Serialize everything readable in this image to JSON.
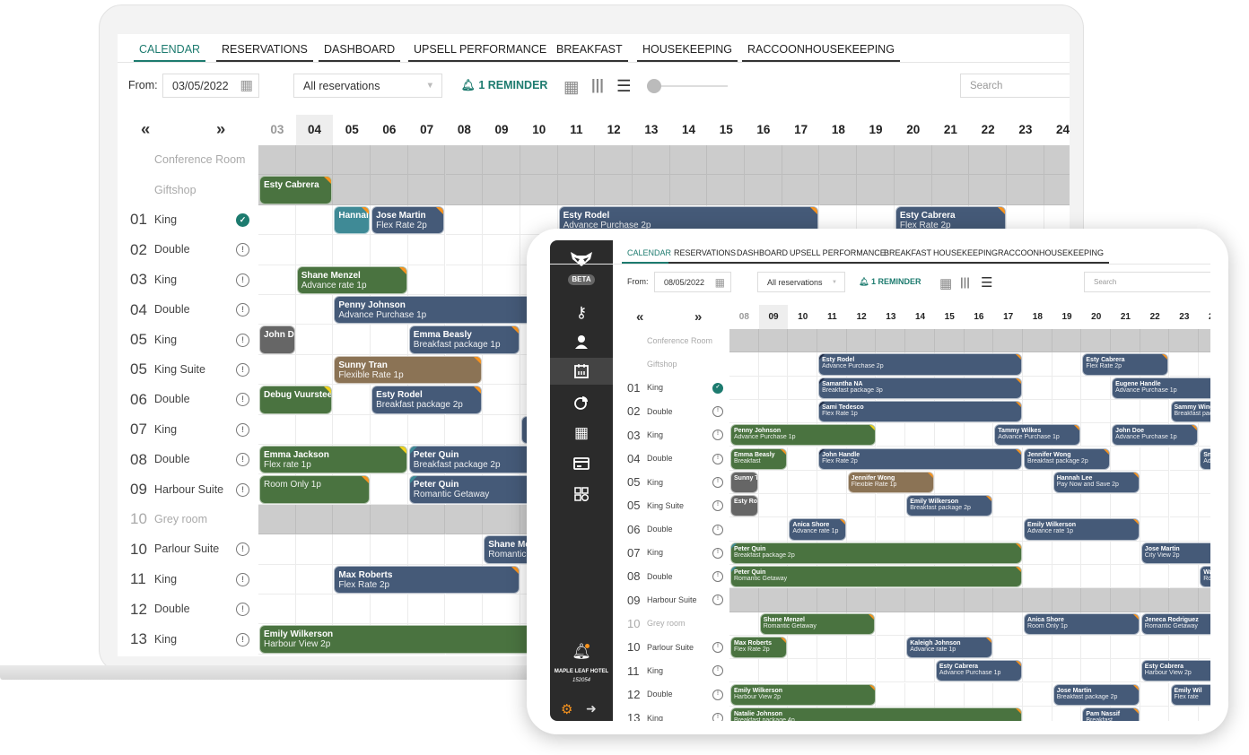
{
  "colors": {
    "blue": "#455a78",
    "green": "#4a7340",
    "teal": "#3f8a96",
    "grey": "#666666",
    "brown": "#8b7355",
    "accent": "#1d7b6f",
    "orange": "#f7931e",
    "yellow": "#f2d21b"
  },
  "laptop": {
    "tabs": [
      "CALENDAR",
      "RESERVATIONS",
      "DASHBOARD",
      "UPSELL PERFORMANCE",
      "BREAKFAST",
      "HOUSEKEEPING",
      "RACCOONHOUSEKEEPING"
    ],
    "from_label": "From:",
    "from_date": "03/05/2022",
    "filter": "All reservations",
    "reminder": "1 REMINDER",
    "search_placeholder": "Search",
    "prev": "«",
    "next": "»",
    "days": [
      "03",
      "04",
      "05",
      "06",
      "07",
      "08",
      "09",
      "10",
      "11",
      "12",
      "13",
      "14",
      "15",
      "16",
      "17",
      "18",
      "19",
      "20",
      "21",
      "22",
      "23",
      "24"
    ],
    "today": "04",
    "rooms": [
      {
        "num": "",
        "name": "Conference Room",
        "status": "none",
        "blocked": true
      },
      {
        "num": "",
        "name": "Giftshop",
        "status": "none",
        "blocked": true
      },
      {
        "num": "01",
        "name": "King",
        "status": "ok"
      },
      {
        "num": "02",
        "name": "Double",
        "status": "alert"
      },
      {
        "num": "03",
        "name": "King",
        "status": "alert"
      },
      {
        "num": "04",
        "name": "Double",
        "status": "alert"
      },
      {
        "num": "05",
        "name": "King",
        "status": "alert"
      },
      {
        "num": "05",
        "name": "King Suite",
        "status": "alert"
      },
      {
        "num": "06",
        "name": "Double",
        "status": "alert"
      },
      {
        "num": "07",
        "name": "King",
        "status": "alert"
      },
      {
        "num": "08",
        "name": "Double",
        "status": "alert"
      },
      {
        "num": "09",
        "name": "Harbour Suite",
        "status": "alert"
      },
      {
        "num": "10",
        "name": "Grey room",
        "status": "none",
        "blocked": true,
        "muted": true
      },
      {
        "num": "10",
        "name": "Parlour Suite",
        "status": "alert"
      },
      {
        "num": "11",
        "name": "King",
        "status": "alert"
      },
      {
        "num": "12",
        "name": "Double",
        "status": "alert"
      },
      {
        "num": "13",
        "name": "King",
        "status": "alert"
      }
    ],
    "bookings": [
      {
        "row": 1,
        "start": "03",
        "nights": 2,
        "name": "Esty Cabrera",
        "rate": "",
        "color": "green",
        "flag": "orange"
      },
      {
        "row": 2,
        "start": "05",
        "nights": 1,
        "name": "Hannal Lee",
        "rate": "",
        "color": "teal",
        "flag": "orange"
      },
      {
        "row": 2,
        "start": "06",
        "nights": 2,
        "name": "Jose Martin",
        "rate": "Flex Rate 2p",
        "color": "blue",
        "flag": "orange"
      },
      {
        "row": 2,
        "start": "11",
        "nights": 7,
        "name": "Esty Rodel",
        "rate": "Advance Purchase 2p",
        "color": "blue",
        "flag": "orange"
      },
      {
        "row": 2,
        "start": "20",
        "nights": 3,
        "name": "Esty Cabrera",
        "rate": "Flex Rate 2p",
        "color": "blue",
        "flag": "orange"
      },
      {
        "row": 4,
        "start": "04",
        "nights": 3,
        "name": "Shane Menzel",
        "rate": "Advance rate 1p",
        "color": "green",
        "flag": "orange"
      },
      {
        "row": 5,
        "start": "05",
        "nights": 8,
        "name": "Penny Johnson",
        "rate": "Advance Purchase 1p",
        "color": "blue",
        "flag": ""
      },
      {
        "row": 6,
        "start": "03",
        "nights": 1,
        "name": "John Doe",
        "rate": "",
        "color": "grey",
        "flag": ""
      },
      {
        "row": 6,
        "start": "07",
        "nights": 3,
        "name": "Emma Beasly",
        "rate": "Breakfast package 1p",
        "color": "blue",
        "flag": "orange"
      },
      {
        "row": 7,
        "start": "05",
        "nights": 4,
        "name": "Sunny Tran",
        "rate": "Flexible Rate 1p",
        "color": "brown",
        "flag": "orange"
      },
      {
        "row": 8,
        "start": "03",
        "nights": 2,
        "name": "Debug Vuursteen",
        "rate": "",
        "color": "green",
        "flag": "yellow"
      },
      {
        "row": 8,
        "start": "06",
        "nights": 3,
        "name": "Esty Rodel",
        "rate": "Breakfast package 2p",
        "color": "blue",
        "flag": "orange"
      },
      {
        "row": 9,
        "start": "10",
        "nights": 4,
        "name": "",
        "rate": "",
        "color": "blue",
        "flag": ""
      },
      {
        "row": 10,
        "start": "03",
        "nights": 4,
        "name": "Emma Jackson",
        "rate": "Flex rate 1p",
        "color": "green",
        "flag": "yellow"
      },
      {
        "row": 10,
        "start": "07",
        "nights": 5,
        "name": "Peter Quin",
        "rate": "Breakfast package 2p",
        "color": "blue",
        "flag": "",
        "lflag": "teal"
      },
      {
        "row": 11,
        "start": "03",
        "nights": 3,
        "name": "",
        "rate": "Room Only 1p",
        "color": "green",
        "flag": "orange"
      },
      {
        "row": 11,
        "start": "07",
        "nights": 5,
        "name": "Peter Quin",
        "rate": "Romantic Getaway",
        "color": "blue",
        "flag": "",
        "lflag": "teal"
      },
      {
        "row": 13,
        "start": "09",
        "nights": 3,
        "name": "Shane Menzel",
        "rate": "Romantic Getaway",
        "color": "blue",
        "flag": ""
      },
      {
        "row": 14,
        "start": "05",
        "nights": 5,
        "name": "Max Roberts",
        "rate": "Flex Rate 2p",
        "color": "blue",
        "flag": "orange"
      },
      {
        "row": 16,
        "start": "03",
        "nights": 10,
        "name": "Emily Wilkerson",
        "rate": "Harbour View 2p",
        "color": "green",
        "flag": ""
      }
    ]
  },
  "tablet": {
    "logo": "raccoon-logo",
    "beta": "BETA",
    "nav_icons": [
      "key-icon",
      "person-icon",
      "calendar-icon",
      "pie-chart-icon",
      "grid-check-icon",
      "credit-card-icon",
      "calculator-icon"
    ],
    "hotel_name": "MAPLE LEAF HOTEL",
    "hotel_id": "152054",
    "tabs": [
      "CALENDAR",
      "RESERVATIONS",
      "DASHBOARD",
      "UPSELL PERFORMANCE",
      "BREAKFAST",
      "HOUSEKEEPING",
      "RACCOONHOUSEKEEPING"
    ],
    "from_label": "From:",
    "from_date": "08/05/2022",
    "filter": "All reservations",
    "reminder": "1 REMINDER",
    "search_placeholder": "Search",
    "prev": "«",
    "next": "»",
    "days": [
      "08",
      "09",
      "10",
      "11",
      "12",
      "13",
      "14",
      "15",
      "16",
      "17",
      "18",
      "19",
      "20",
      "21",
      "22",
      "23",
      "24"
    ],
    "today": "09",
    "rooms": [
      {
        "num": "",
        "name": "Conference Room",
        "status": "none",
        "blocked": true
      },
      {
        "num": "",
        "name": "Giftshop",
        "status": "none"
      },
      {
        "num": "01",
        "name": "King",
        "status": "ok"
      },
      {
        "num": "02",
        "name": "Double",
        "status": "alert"
      },
      {
        "num": "03",
        "name": "King",
        "status": "alert"
      },
      {
        "num": "04",
        "name": "Double",
        "status": "alert"
      },
      {
        "num": "05",
        "name": "King",
        "status": "alert"
      },
      {
        "num": "05",
        "name": "King Suite",
        "status": "alert"
      },
      {
        "num": "06",
        "name": "Double",
        "status": "alert"
      },
      {
        "num": "07",
        "name": "King",
        "status": "alert"
      },
      {
        "num": "08",
        "name": "Double",
        "status": "alert"
      },
      {
        "num": "09",
        "name": "Harbour Suite",
        "status": "alert",
        "blocked": true
      },
      {
        "num": "10",
        "name": "Grey room",
        "status": "none",
        "muted": true
      },
      {
        "num": "10",
        "name": "Parlour Suite",
        "status": "alert"
      },
      {
        "num": "11",
        "name": "King",
        "status": "alert"
      },
      {
        "num": "12",
        "name": "Double",
        "status": "alert"
      },
      {
        "num": "13",
        "name": "King",
        "status": "alert"
      }
    ],
    "bookings": [
      {
        "row": 1,
        "start": "11",
        "nights": 7,
        "name": "Esty Rodel",
        "rate": "Advance Purchase 2p",
        "color": "blue",
        "flag": "orange",
        "lflag": "navy"
      },
      {
        "row": 1,
        "start": "20",
        "nights": 3,
        "name": "Esty Cabrera",
        "rate": "Flex Rate 2p",
        "color": "blue",
        "flag": "orange"
      },
      {
        "row": 2,
        "start": "11",
        "nights": 7,
        "name": "Samantha NA",
        "rate": "Breakfast package 3p",
        "color": "blue",
        "flag": "orange",
        "lflag": "navy"
      },
      {
        "row": 2,
        "start": "21",
        "nights": 4,
        "name": "Eugene Handle",
        "rate": "Advance Purchase 1p",
        "color": "blue",
        "flag": ""
      },
      {
        "row": 3,
        "start": "11",
        "nights": 7,
        "name": "Sami Tedesco",
        "rate": "Flex Rate 1p",
        "color": "blue",
        "flag": "orange",
        "lflag": "navy"
      },
      {
        "row": 3,
        "start": "23",
        "nights": 2,
        "name": "Sammy Wing",
        "rate": "Breakfast package",
        "color": "blue",
        "flag": ""
      },
      {
        "row": 4,
        "start": "08",
        "nights": 5,
        "name": "Penny Johnson",
        "rate": "Advance Purchase 1p",
        "color": "green",
        "flag": "yellow"
      },
      {
        "row": 4,
        "start": "17",
        "nights": 3,
        "name": "Tammy Wilkes",
        "rate": "Advance Purchase 1p",
        "color": "blue",
        "flag": "orange"
      },
      {
        "row": 4,
        "start": "21",
        "nights": 3,
        "name": "John Doe",
        "rate": "Advance Purchase 1p",
        "color": "blue",
        "flag": "orange"
      },
      {
        "row": 5,
        "start": "08",
        "nights": 2,
        "name": "Emma Beasly",
        "rate": "Breakfast",
        "color": "green",
        "flag": "orange"
      },
      {
        "row": 5,
        "start": "11",
        "nights": 7,
        "name": "John Handle",
        "rate": "Flex Rate 2p",
        "color": "blue",
        "flag": "orange",
        "lflag": "navy"
      },
      {
        "row": 5,
        "start": "18",
        "nights": 3,
        "name": "Jennifer Wong",
        "rate": "Breakfast package 2p",
        "color": "blue",
        "flag": "orange"
      },
      {
        "row": 5,
        "start": "24",
        "nights": 2,
        "name": "Sn",
        "rate": "Ad",
        "color": "blue",
        "flag": ""
      },
      {
        "row": 6,
        "start": "08",
        "nights": 1,
        "name": "Sunny Tran",
        "rate": "",
        "color": "grey",
        "flag": ""
      },
      {
        "row": 6,
        "start": "12",
        "nights": 3,
        "name": "Jennifer Wong",
        "rate": "Flexible Rate 1p",
        "color": "brown",
        "flag": "orange"
      },
      {
        "row": 6,
        "start": "19",
        "nights": 3,
        "name": "Hannah Lee",
        "rate": "Pay Now and Save 2p",
        "color": "blue",
        "flag": "orange"
      },
      {
        "row": 7,
        "start": "08",
        "nights": 1,
        "name": "Esty Rodel",
        "rate": "",
        "color": "grey",
        "flag": ""
      },
      {
        "row": 7,
        "start": "14",
        "nights": 3,
        "name": "Emily Wilkerson",
        "rate": "Breakfast package 2p",
        "color": "blue",
        "flag": "orange"
      },
      {
        "row": 8,
        "start": "10",
        "nights": 2,
        "name": "Anica Shore",
        "rate": "Advance rate 1p",
        "color": "blue",
        "flag": "orange"
      },
      {
        "row": 8,
        "start": "18",
        "nights": 4,
        "name": "Emily Wilkerson",
        "rate": "Advance rate 1p",
        "color": "blue",
        "flag": "orange"
      },
      {
        "row": 9,
        "start": "08",
        "nights": 10,
        "name": "Peter Quin",
        "rate": "Breakfast package 2p",
        "color": "green",
        "flag": "orange",
        "lflag": "teal"
      },
      {
        "row": 9,
        "start": "22",
        "nights": 3,
        "name": "Jose Martin",
        "rate": "City View 2p",
        "color": "blue",
        "flag": ""
      },
      {
        "row": 10,
        "start": "08",
        "nights": 10,
        "name": "Peter Quin",
        "rate": "Romantic Getaway",
        "color": "green",
        "flag": "orange",
        "lflag": "teal"
      },
      {
        "row": 10,
        "start": "24",
        "nights": 2,
        "name": "Wa",
        "rate": "Ro",
        "color": "blue",
        "flag": ""
      },
      {
        "row": 12,
        "start": "09",
        "nights": 4,
        "name": "Shane Menzel",
        "rate": "Romantic Getaway",
        "color": "green",
        "flag": "orange"
      },
      {
        "row": 12,
        "start": "18",
        "nights": 4,
        "name": "Anica Shore",
        "rate": "Room Only 1p",
        "color": "blue",
        "flag": "orange"
      },
      {
        "row": 12,
        "start": "22",
        "nights": 3,
        "name": "Jeneca Rodriguez",
        "rate": "Romantic Getaway",
        "color": "blue",
        "flag": ""
      },
      {
        "row": 13,
        "start": "08",
        "nights": 2,
        "name": "Max Roberts",
        "rate": "Flex Rate 2p",
        "color": "green",
        "flag": "orange"
      },
      {
        "row": 13,
        "start": "14",
        "nights": 3,
        "name": "Kaleigh Johnson",
        "rate": "Advance rate 1p",
        "color": "blue",
        "flag": "orange"
      },
      {
        "row": 14,
        "start": "15",
        "nights": 3,
        "name": "Esty Cabrera",
        "rate": "Advance Purchase 1p",
        "color": "blue",
        "flag": "orange"
      },
      {
        "row": 14,
        "start": "22",
        "nights": 3,
        "name": "Esty Cabrera",
        "rate": "Harbour View 2p",
        "color": "blue",
        "flag": ""
      },
      {
        "row": 15,
        "start": "08",
        "nights": 5,
        "name": "Emily Wilkerson",
        "rate": "Harbour View 2p",
        "color": "green",
        "flag": "orange"
      },
      {
        "row": 15,
        "start": "19",
        "nights": 3,
        "name": "Jose Martin",
        "rate": "Breakfast package 2p",
        "color": "blue",
        "flag": "orange"
      },
      {
        "row": 15,
        "start": "23",
        "nights": 2,
        "name": "Emily Wil",
        "rate": "Flex rate",
        "color": "blue",
        "flag": ""
      },
      {
        "row": 16,
        "start": "08",
        "nights": 10,
        "name": "Natalie Johnson",
        "rate": "Breakfast package 4p",
        "color": "green",
        "flag": "orange"
      },
      {
        "row": 16,
        "start": "20",
        "nights": 2,
        "name": "Pam Nassif",
        "rate": "Breakfast",
        "color": "blue",
        "flag": "orange"
      }
    ]
  }
}
